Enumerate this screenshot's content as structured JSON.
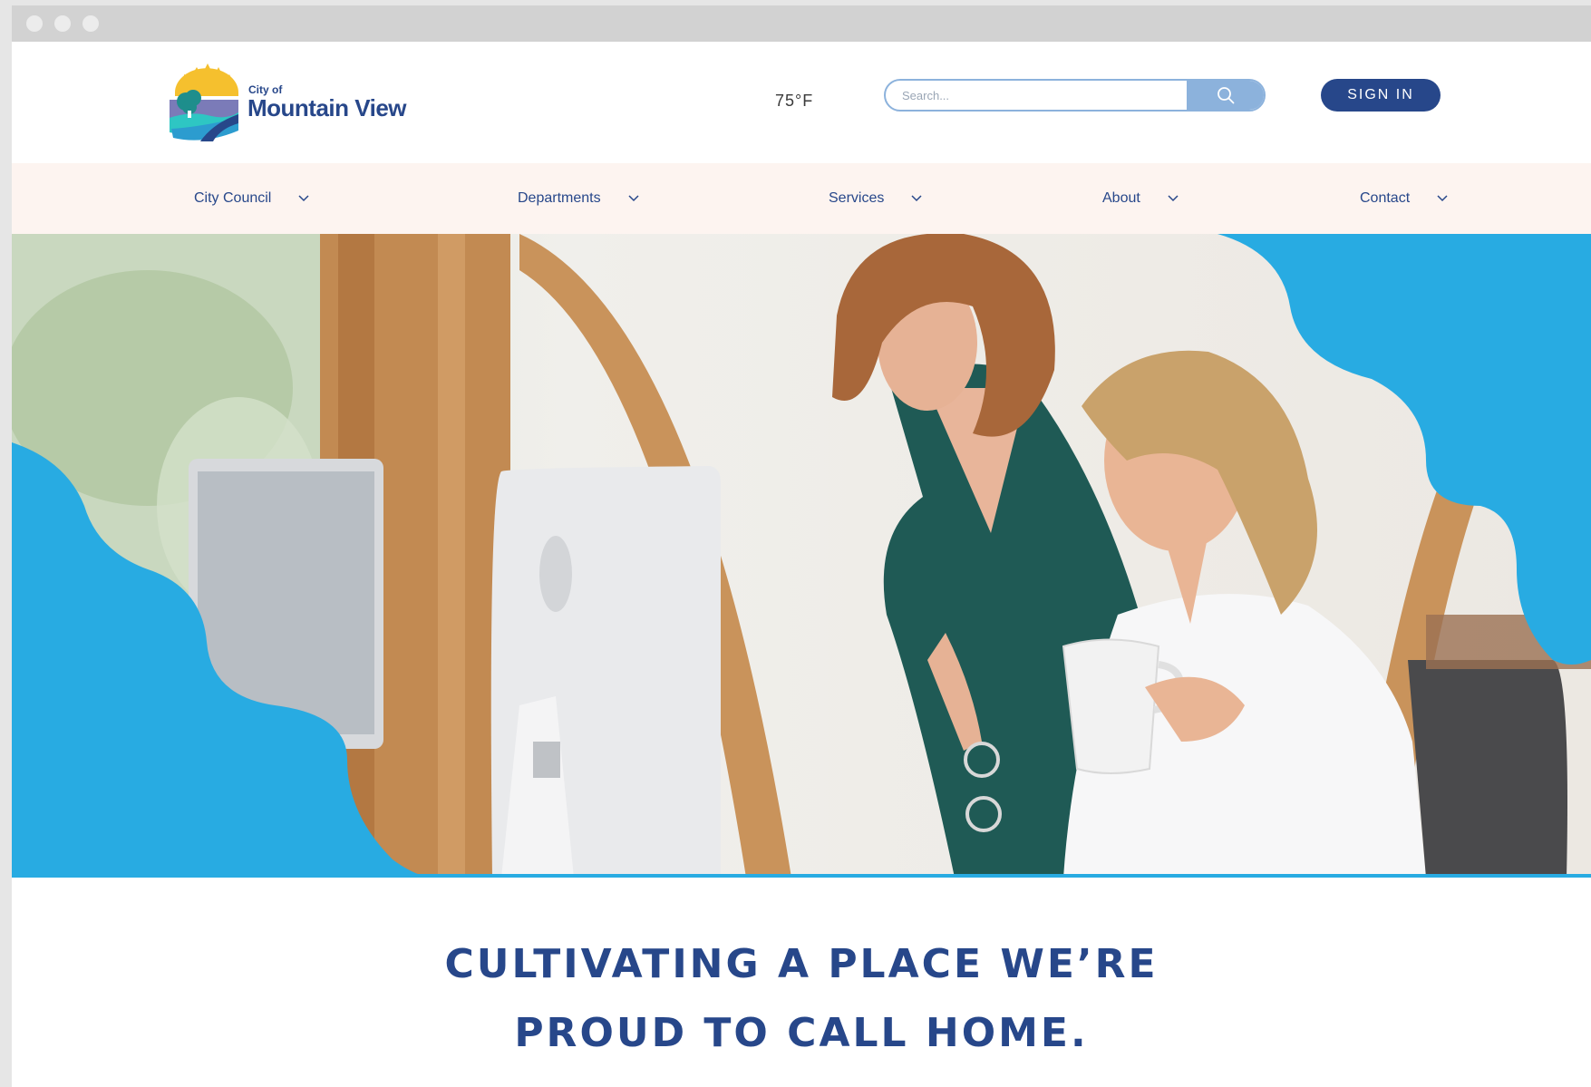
{
  "logo": {
    "small_text": "City of",
    "name": "Mountain View"
  },
  "header": {
    "weather": "75°F",
    "signin_label": "SIGN IN"
  },
  "search": {
    "placeholder": "Search..."
  },
  "nav": {
    "items": [
      {
        "label": "City Council"
      },
      {
        "label": "Departments"
      },
      {
        "label": "Services"
      },
      {
        "label": "About"
      },
      {
        "label": "Contact"
      }
    ]
  },
  "hero": {
    "tagline_line1": "CULTIVATING A PLACE WE’RE",
    "tagline_line2": "PROUD TO CALL HOME."
  },
  "colors": {
    "brand_blue": "#27478a",
    "accent_blue": "#28abe2",
    "nav_bg": "#fdf4f0",
    "search_accent": "#8cb2dc"
  },
  "icons": {
    "search": "search-icon",
    "chevron": "chevron-down-icon"
  }
}
